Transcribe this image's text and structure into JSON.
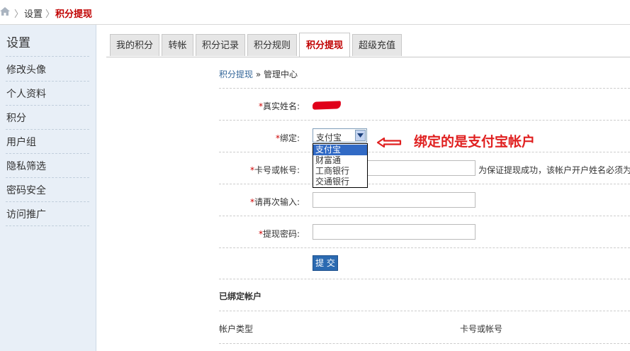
{
  "breadcrumb": {
    "parent": "设置",
    "current": "积分提现"
  },
  "sidebar": {
    "title": "设置",
    "items": [
      {
        "label": "修改头像"
      },
      {
        "label": "个人资料"
      },
      {
        "label": "积分"
      },
      {
        "label": "用户组"
      },
      {
        "label": "隐私筛选"
      },
      {
        "label": "密码安全"
      },
      {
        "label": "访问推广"
      }
    ]
  },
  "tabs": [
    {
      "label": "我的积分"
    },
    {
      "label": "转帐"
    },
    {
      "label": "积分记录"
    },
    {
      "label": "积分规则"
    },
    {
      "label": "积分提现",
      "active": true
    },
    {
      "label": "超级充值"
    }
  ],
  "page_crumb": {
    "link": "积分提现",
    "sep": "»",
    "current": "管理中心"
  },
  "form": {
    "required_mark": "*",
    "real_name_label": "真实姓名:",
    "bind_label": "绑定:",
    "bind_selected": "支付宝",
    "bind_options": [
      "支付宝",
      "财富通",
      "工商银行",
      "交通银行"
    ],
    "account_label": "卡号或帐号:",
    "account_hint": "为保证提现成功，该帐户开户姓名必须为",
    "reenter_label": "请再次输入:",
    "withdraw_password_label": "提现密码:",
    "submit_label": "提 交"
  },
  "annotation": {
    "text": "绑定的是支付宝帐户",
    "color": "#e02020"
  },
  "bound_accounts": {
    "title": "已绑定帐户",
    "columns": [
      "帐户类型",
      "卡号或帐号"
    ]
  },
  "colors": {
    "accent": "#c00000",
    "sidebar_bg": "#e8eff7",
    "button_bg": "#2b6ab1"
  }
}
